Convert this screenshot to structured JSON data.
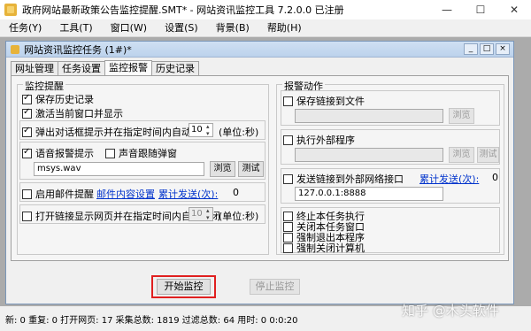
{
  "window": {
    "title": "政府网站最新政策公告监控提醒.SMT* - 网站资讯监控工具 7.2.0.0 已注册",
    "controls": [
      "—",
      "☐",
      "✕"
    ]
  },
  "menu": [
    "任务(Y)",
    "工具(T)",
    "窗口(W)",
    "设置(S)",
    "背景(B)",
    "帮助(H)"
  ],
  "task_window": {
    "title": "网站资讯监控任务 (1#)*",
    "buttons": [
      "_",
      "□",
      "×"
    ]
  },
  "tabs": [
    "网址管理",
    "任务设置",
    "监控报警",
    "历史记录"
  ],
  "alert": {
    "group_title": "监控提醒",
    "save_history": "保存历史记录",
    "activate_main": "激活当前窗口并显示",
    "popup_label": "弹出对话框提示并在指定时间内自动关闭",
    "popup_seconds": "10",
    "popup_unit": "(单位:秒)",
    "voice_label": "语音报警提示",
    "voice_popup": "声音跟随弹窗",
    "sound_file": "msys.wav",
    "browse": "浏览",
    "test": "测试",
    "email_label": "启用邮件提醒",
    "email_content_link": "邮件内容设置",
    "email_sent_label": "累计发送(次):",
    "email_sent_count": "0",
    "open_link_label": "打开链接显示网页并在指定时间内自动关闭",
    "open_link_seconds": "10",
    "open_link_unit": "(单位:秒)"
  },
  "actions": {
    "group_title": "报警动作",
    "save_link_file": "保存链接到文件",
    "browse": "浏览",
    "run_program": "执行外部程序",
    "test": "测试",
    "send_link": "发送链接到外部网络接口",
    "send_count_link": "累计发送(次):",
    "send_count": "0",
    "endpoint": "127.0.0.1:8888",
    "stop_task": "终止本任务执行",
    "close_window": "关闭本任务窗口",
    "exit_program": "强制退出本程序",
    "shutdown": "强制关闭计算机"
  },
  "controls": {
    "start": "开始监控",
    "stop": "停止监控"
  },
  "status": "新: 0 重复: 0 打开网页: 17 采集总数: 1819 过滤总数: 64 用时: 0 0:0:20",
  "watermark": "知乎 @木头软件",
  "colors": {
    "highlight": "#e02020",
    "link": "#0033cc"
  }
}
